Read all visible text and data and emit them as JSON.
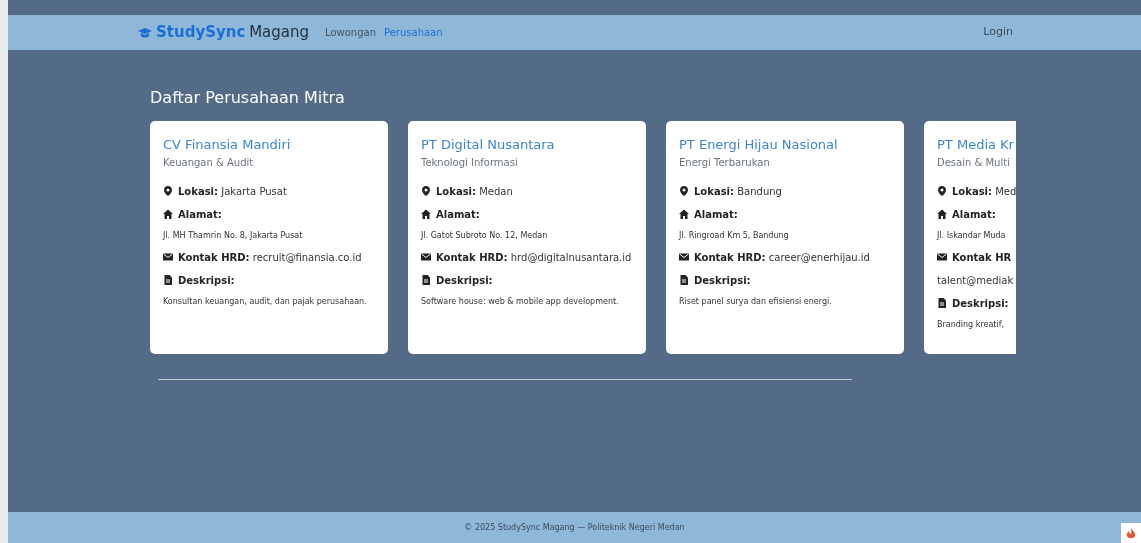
{
  "navbar": {
    "brand_primary": "StudySync",
    "brand_secondary": "Magang",
    "links": [
      {
        "label": "Lowongan",
        "selected": false
      },
      {
        "label": "Perusahaan",
        "selected": true
      }
    ],
    "login": "Login"
  },
  "heading": "Daftar Perusahaan Mitra",
  "companies": [
    {
      "name": "CV Finansia Mandiri",
      "sector": "Keuangan & Audit",
      "location_label": "Lokasi:",
      "location": "Jakarta Pusat",
      "address_label": "Alamat:",
      "address": "Jl. MH Thamrin No. 8, Jakarta Pusat",
      "contact_label": "Kontak HRD:",
      "contact": "recruit@finansia.co.id",
      "description_label": "Deskripsi:",
      "description": "Konsultan keuangan, audit, dan pajak perusahaan."
    },
    {
      "name": "PT Digital Nusantara",
      "sector": "Teknologi Informasi",
      "location_label": "Lokasi:",
      "location": "Medan",
      "address_label": "Alamat:",
      "address": "Jl. Gatot Subroto No. 12, Medan",
      "contact_label": "Kontak HRD:",
      "contact": "hrd@digitalnusantara.id",
      "description_label": "Deskripsi:",
      "description": "Software house: web & mobile app development."
    },
    {
      "name": "PT Energi Hijau Nasional",
      "sector": "Energi Terbarukan",
      "location_label": "Lokasi:",
      "location": "Bandung",
      "address_label": "Alamat:",
      "address": "Jl. Ringroad Km 5, Bandung",
      "contact_label": "Kontak HRD:",
      "contact": "career@enerhijau.id",
      "description_label": "Deskripsi:",
      "description": "Riset panel surya dan efisiensi energi."
    },
    {
      "name": "PT Media Kr",
      "sector": "Desain & Multi",
      "location_label": "Lokasi:",
      "location": "Med",
      "address_label": "Alamat:",
      "address": "Jl. Iskandar Muda",
      "contact_label": "Kontak HR",
      "contact": "talent@mediak",
      "description_label": "Deskripsi:",
      "description": "Branding kreatif,"
    }
  ],
  "footer": "© 2025 StudySync Magang — Politeknik Negeri Medan"
}
